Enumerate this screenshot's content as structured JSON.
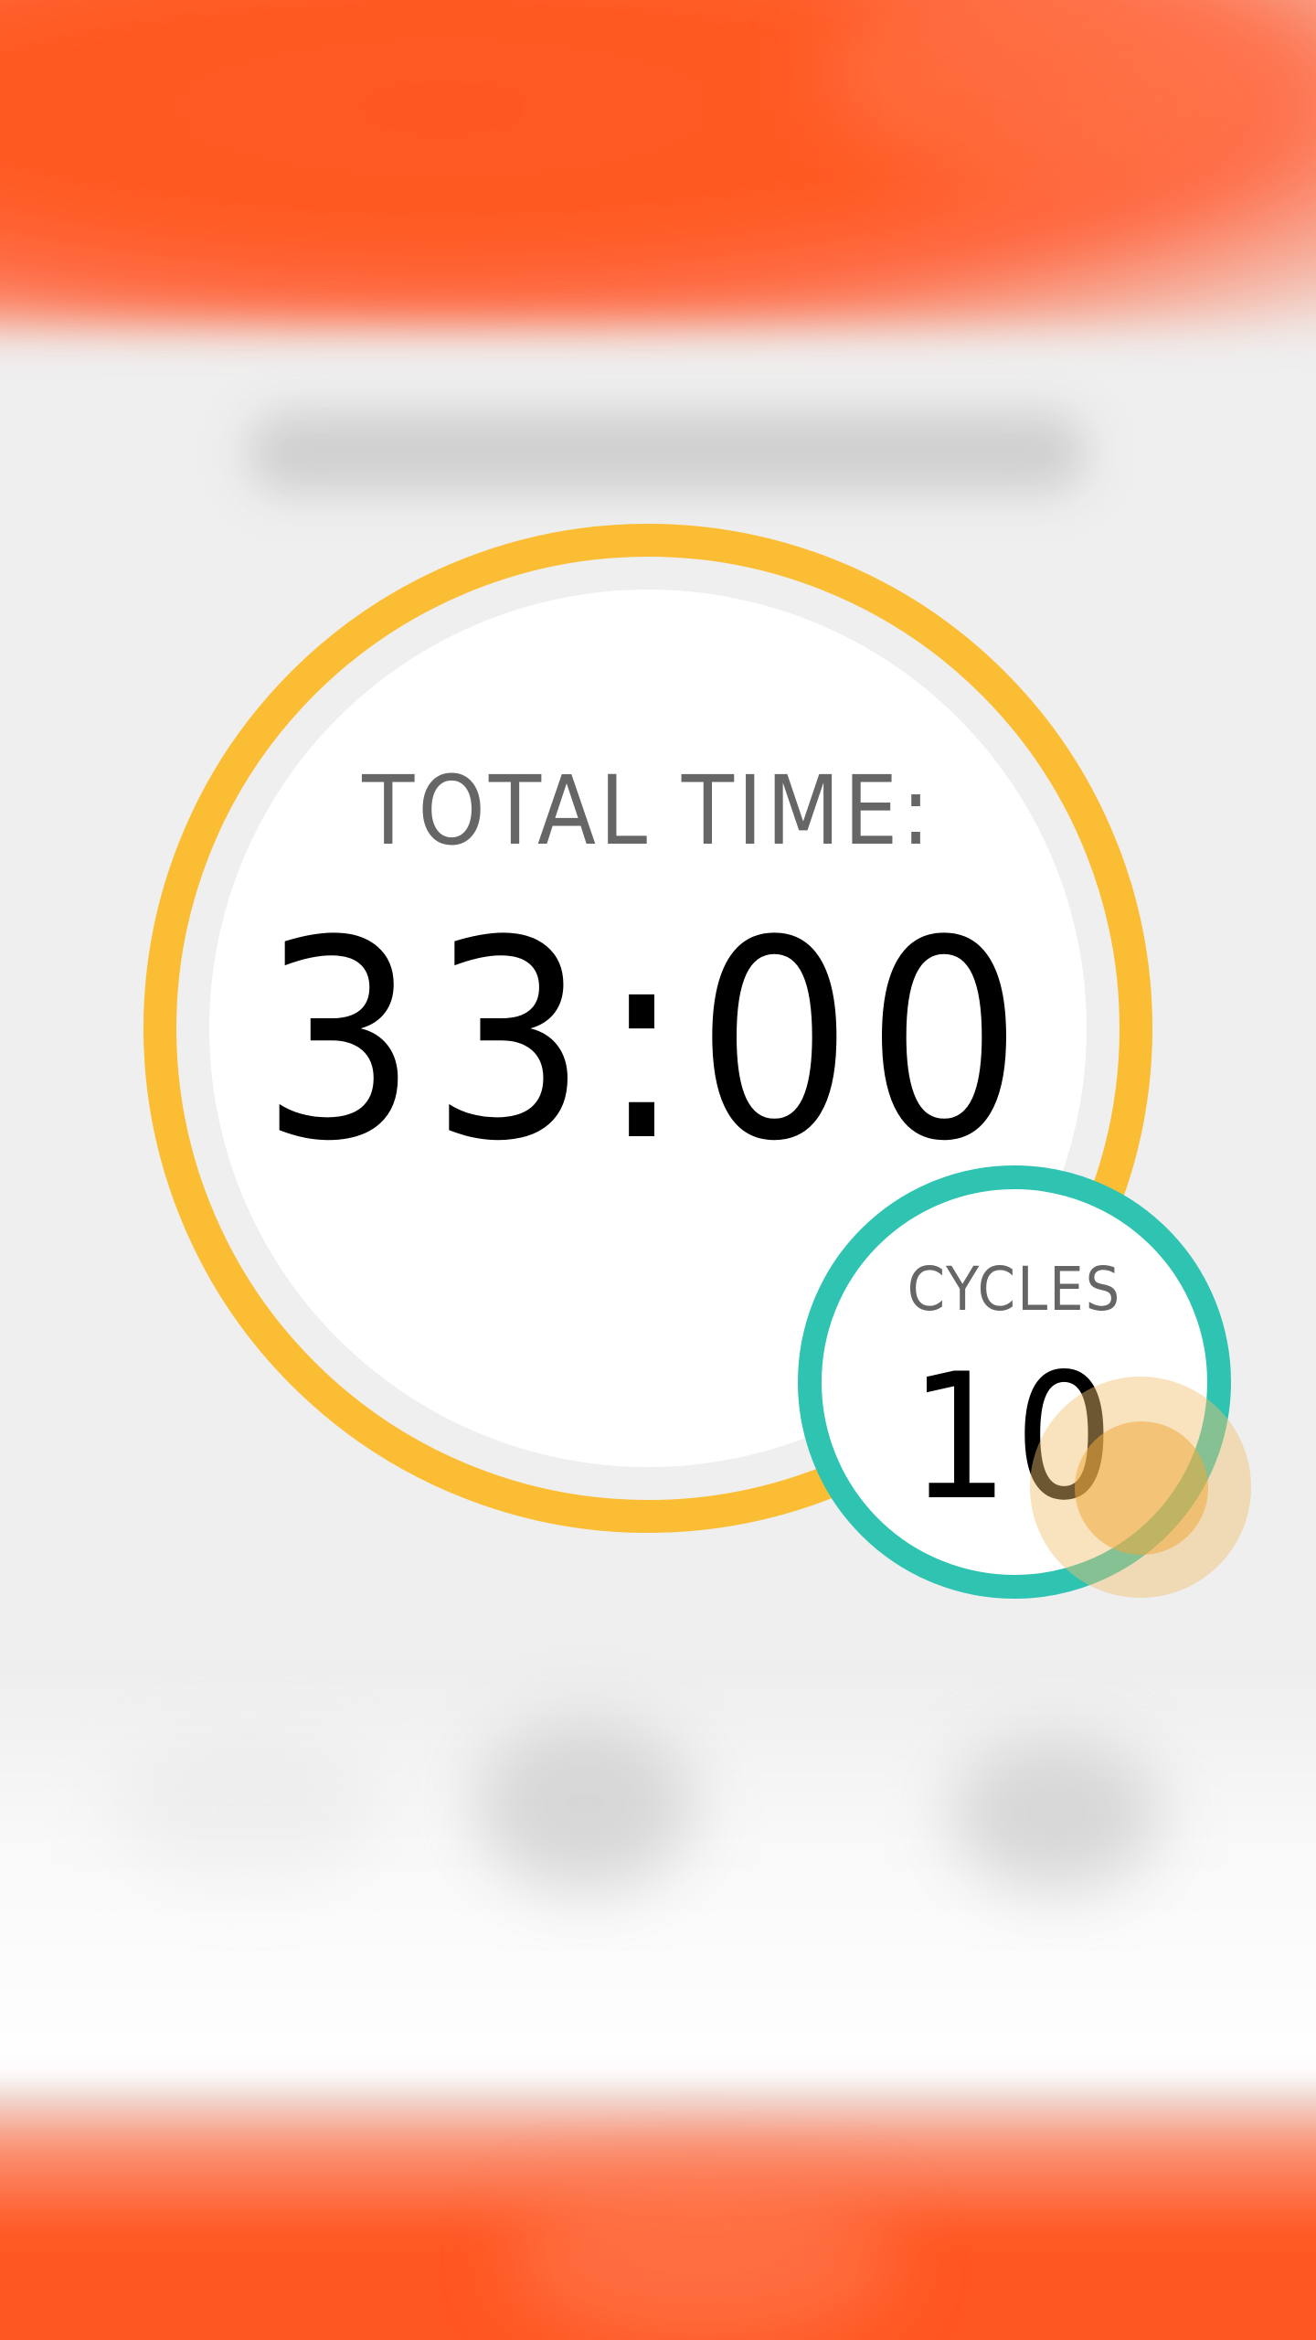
{
  "colors": {
    "header_orange": "#ff5722",
    "total_ring": "#fbbd34",
    "cycles_ring": "#2fc3b2",
    "face": "#ffffff",
    "background": "#efefef",
    "label_gray": "#666666",
    "value_black": "#000000",
    "touch_indicator": "#f1be6e"
  },
  "total_time": {
    "label": "TOTAL TIME:",
    "value": "33:00"
  },
  "cycles": {
    "label": "CYCLES",
    "value": "10"
  }
}
